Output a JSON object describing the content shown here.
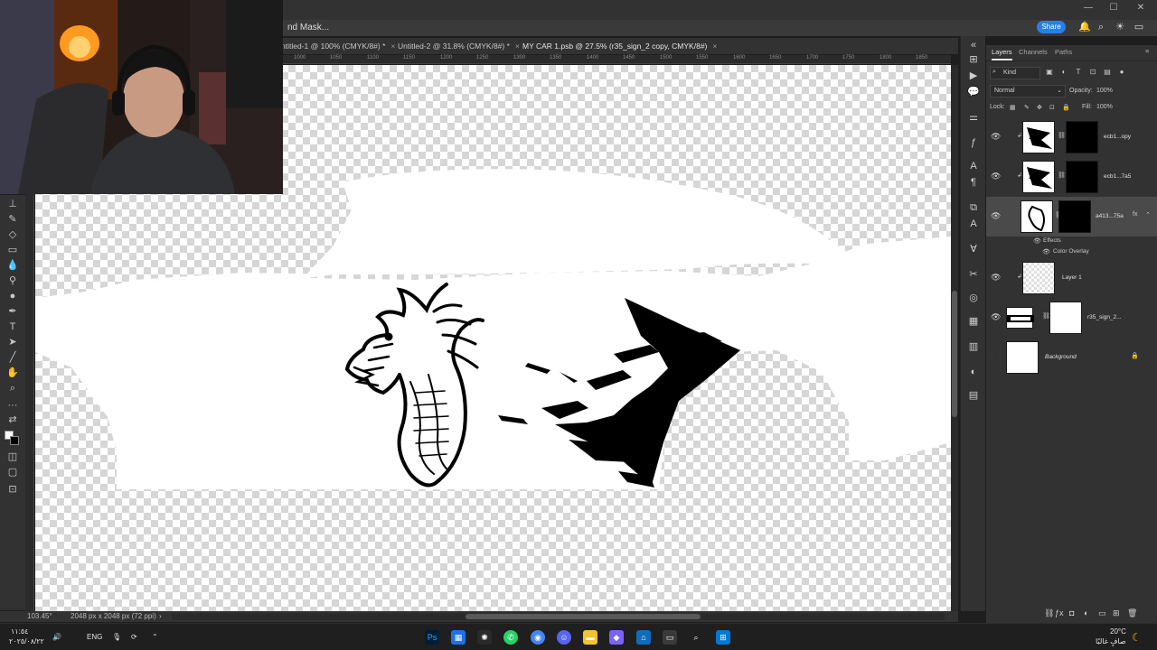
{
  "app": {
    "partial_title": "nd Mask...",
    "share_label": "Share"
  },
  "tabs": [
    {
      "label": "ntitled-1 @ 100% (CMYK/8#) *"
    },
    {
      "label": "Untitled-2 @ 31.8% (CMYK/8#) *"
    },
    {
      "label": "MY CAR 1.psb @ 27.5% (r35_sign_2 copy, CMYK/8#)"
    }
  ],
  "ruler_ticks": [
    "650",
    "700",
    "750",
    "800",
    "850",
    "900",
    "950",
    "1000",
    "1050",
    "1100",
    "1150",
    "1200",
    "1250",
    "1300",
    "1350",
    "1400",
    "1450",
    "1500",
    "1550",
    "1600",
    "1650",
    "1700",
    "1750",
    "1800",
    "1850"
  ],
  "status": {
    "zoom": "103.45°",
    "doc_info": "2048 px x 2048 px (72 ppi)"
  },
  "panel": {
    "tabs": [
      "Layers",
      "Channels",
      "Paths"
    ],
    "kind_label": "Kind",
    "blend_mode": "Normal",
    "opacity_label": "Opacity:",
    "opacity_value": "100%",
    "lock_label": "Lock:",
    "fill_label": "Fill:",
    "fill_value": "100%",
    "effects_label": "Effects",
    "color_overlay_label": "Color Overlay",
    "fx_label": "fx"
  },
  "layers": [
    {
      "name": "ecb1...opy",
      "visible": true,
      "selected": false
    },
    {
      "name": "ecb1...7a5",
      "visible": true,
      "selected": false
    },
    {
      "name": "a413...75a",
      "visible": true,
      "selected": true
    },
    {
      "name": "Layer 1",
      "visible": true,
      "selected": false
    },
    {
      "name": "r35_sign_2...",
      "visible": true,
      "selected": false
    },
    {
      "name": "Background",
      "visible": false,
      "selected": false
    }
  ],
  "taskbar": {
    "time": "١١:٥٤",
    "date": "٢٠٢٥/٠٨/٢٢",
    "lang": "ENG",
    "temperature": "20°C",
    "weather": "صافٍ غالبًا"
  }
}
